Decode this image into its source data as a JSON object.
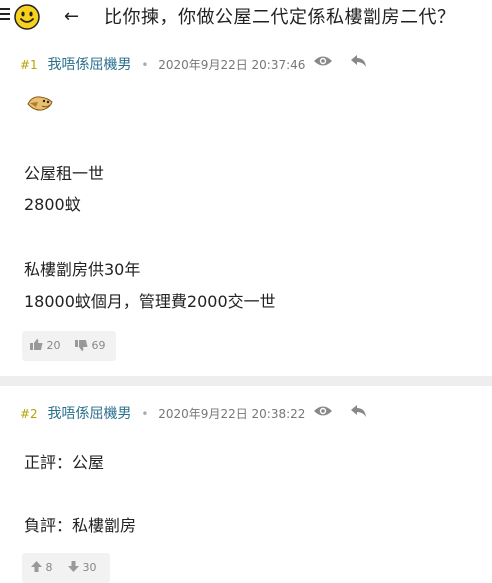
{
  "header": {
    "back_label": "←",
    "title": "比你揀，你做公屋二代定係私樓劏房二代？"
  },
  "posts": [
    {
      "number": "#1",
      "username": "我唔係屈機男",
      "timestamp": "2020年9月22日 20:37:46",
      "lines": [
        "公屋租一世",
        "2800蚊",
        "私樓劏房供30年",
        "18000蚊個月，管理費2000交一世"
      ],
      "likes": "20",
      "dislikes": "69"
    },
    {
      "number": "#2",
      "username": "我唔係屈機男",
      "timestamp": "2020年9月22日 20:38:22",
      "lines": [
        "正評：公屋",
        "負評：私樓劏房"
      ],
      "likes": "8",
      "dislikes": "30"
    }
  ],
  "colors": {
    "post_number": "#b5a300",
    "username": "#2a6f8f",
    "divider": "#eeeeee"
  }
}
